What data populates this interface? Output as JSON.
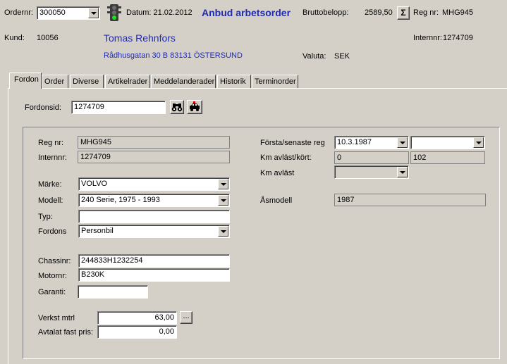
{
  "header": {
    "ordernr_label": "Ordernr:",
    "ordernr_value": "300050",
    "datum": "Datum: 21.02.2012",
    "title": "Anbud arbetsorder",
    "bruttobelopp_label": "Bruttobelopp:",
    "bruttobelopp_value": "2589,50",
    "sum_symbol": "Σ",
    "regnr_label": "Reg nr:",
    "regnr_value": "MHG945",
    "kund_label": "Kund:",
    "kund_value": "10056",
    "customer_name": "Tomas Rehnfors",
    "address": "Rådhusgatan 30 B 83131 ÖSTERSUND",
    "internnr_label": "Internnr:",
    "internnr_value": "1274709",
    "valuta_label": "Valuta:",
    "valuta_value": "SEK"
  },
  "tabs": [
    "Fordon",
    "Order",
    "Diverse",
    "Artikelrader",
    "Meddelanderader",
    "Historik",
    "Terminorder"
  ],
  "fordonsid": {
    "label": "Fordonsid:",
    "value": "1274709"
  },
  "vehicle": {
    "regnr_label": "Reg nr:",
    "regnr_value": "MHG945",
    "internnr_label": "Internnr:",
    "internnr_value": "1274709",
    "marke_label": "Märke:",
    "marke_value": "VOLVO",
    "modell_label": "Modell:",
    "modell_value": "240 Serie, 1975 - 1993",
    "typ_label": "Typ:",
    "typ_value": "",
    "fordons_label": "Fordons",
    "fordons_value": "Personbil",
    "chassinr_label": "Chassinr:",
    "chassinr_value": "244833H1232254",
    "motornr_label": "Motornr:",
    "motornr_value": "B230K",
    "garanti_label": "Garanti:",
    "garanti_value": "",
    "verkst_label": "Verkst mtrl",
    "verkst_value": "63,00",
    "avtalat_label": "Avtalat fast pris:",
    "avtalat_value": "0,00",
    "ellipsis": "...",
    "forsta_label": "Första/senaste reg",
    "forsta_value": "10.3.1987",
    "senaste_value": "",
    "km_avlast_kort_label": "Km avläst/kört:",
    "km_avlast_value": "0",
    "km_kort_value": "102",
    "km_avlast2_label": "Km avläst",
    "km_avlast2_value": "",
    "asmodell_label": "Åsmodell",
    "asmodell_value": "1987"
  }
}
